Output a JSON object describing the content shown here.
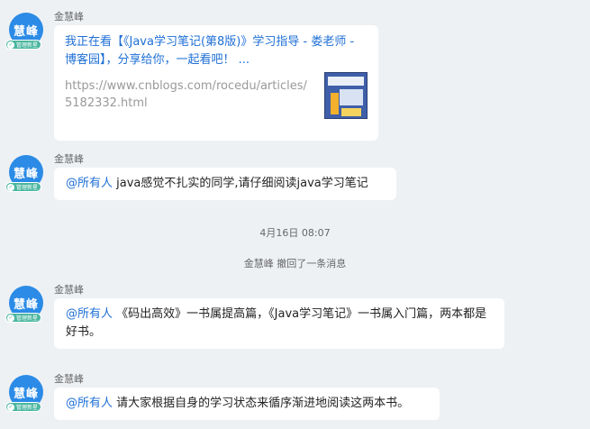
{
  "messages": [
    {
      "sender": "金慧峰",
      "avatar_text": "慧峰",
      "badge_text": "管理新星",
      "type": "link",
      "link_title": "我正在看【《Java学习笔记(第8版)》学习指导 - 娄老师 - 博客园】，分享给你，一起看吧！ ...",
      "link_url": "https://www.cnblogs.com/rocedu/articles/5182332.html"
    },
    {
      "sender": "金慧峰",
      "avatar_text": "慧峰",
      "badge_text": "管理新星",
      "type": "text",
      "mention": "@所有人",
      "text": " java感觉不扎实的同学,请仔细阅读java学习笔记"
    },
    {
      "sender": "金慧峰",
      "avatar_text": "慧峰",
      "badge_text": "管理新星",
      "type": "text",
      "mention": "@所有人",
      "text": " 《码出高效》一书属提高篇，《Java学习笔记》一书属入门篇，两本都是好书。"
    },
    {
      "sender": "金慧峰",
      "avatar_text": "慧峰",
      "badge_text": "管理新星",
      "type": "text",
      "mention": "@所有人",
      "text": " 请大家根据自身的学习状态来循序渐进地阅读这两本书。"
    }
  ],
  "timestamp": "4月16日  08:07",
  "recall_notice": "金慧峰 撤回了一条消息",
  "colors": {
    "background": "#eef1f4",
    "avatar": "#2b8be6",
    "link": "#1e6fd6",
    "badge": "#4ab6a0"
  }
}
